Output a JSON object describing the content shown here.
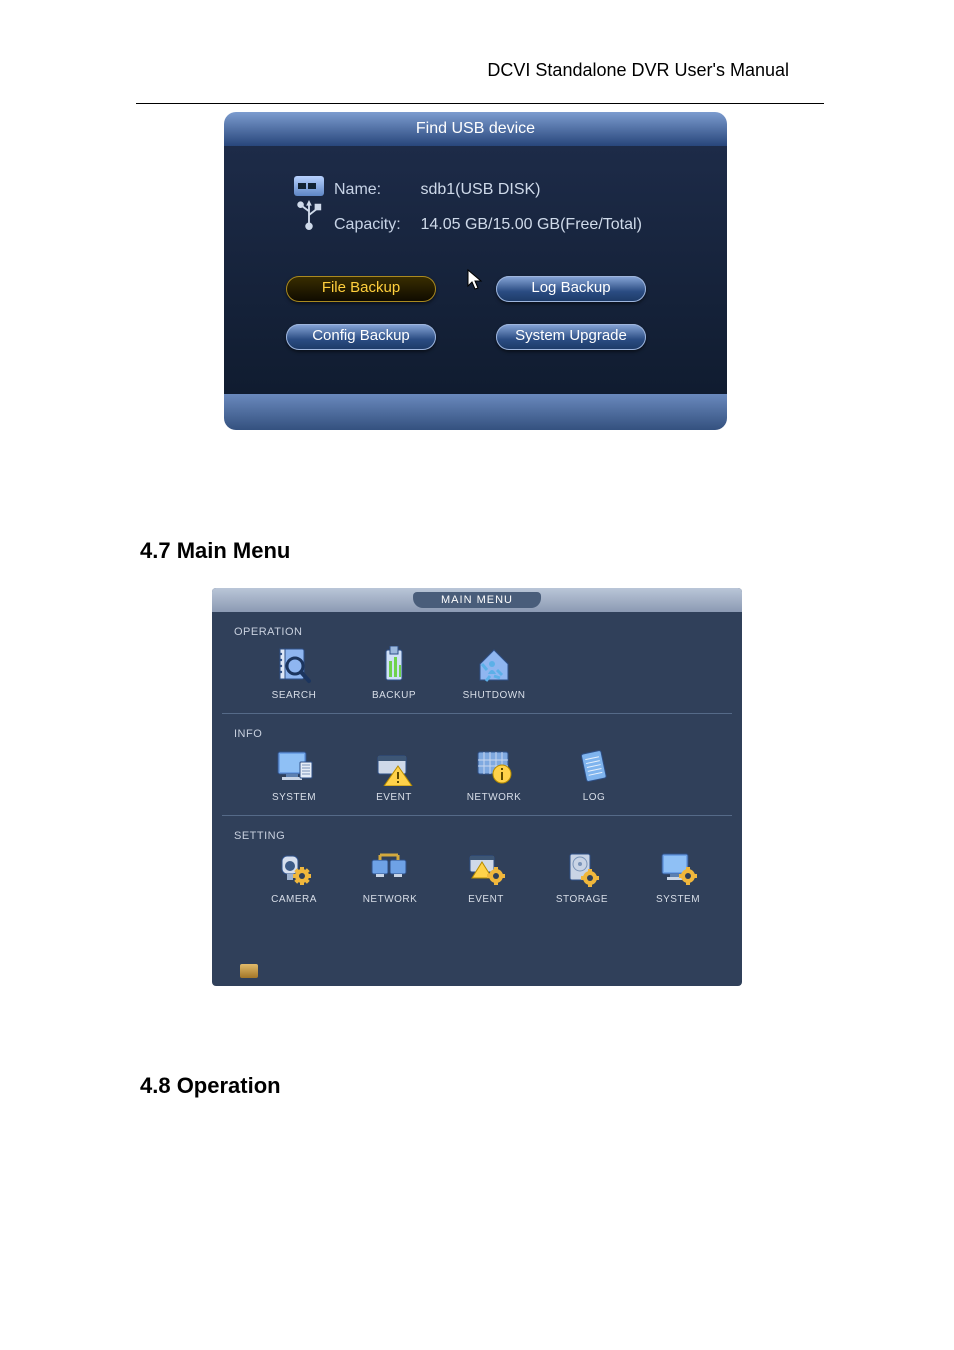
{
  "header": "DCVI Standalone DVR User's Manual",
  "usbDialog": {
    "title": "Find USB device",
    "nameLabel": "Name:",
    "nameValue": "sdb1(USB DISK)",
    "capLabel": "Capacity:",
    "capValue": "14.05 GB/15.00 GB(Free/Total)",
    "btnFileBackup": "File Backup",
    "btnLogBackup": "Log Backup",
    "btnConfigBackup": "Config Backup",
    "btnSystemUpgrade": "System Upgrade"
  },
  "section47": "4.7  Main Menu",
  "section48": "4.8  Operation",
  "mainMenu": {
    "title": "MAIN MENU",
    "catOperation": "OPERATION",
    "catInfo": "INFO",
    "catSetting": "SETTING",
    "operation": {
      "search": "SEARCH",
      "backup": "BACKUP",
      "shutdown": "SHUTDOWN"
    },
    "info": {
      "system": "SYSTEM",
      "event": "EVENT",
      "network": "NETWORK",
      "log": "LOG"
    },
    "setting": {
      "camera": "CAMERA",
      "network": "NETWORK",
      "event": "EVENT",
      "storage": "STORAGE",
      "system": "SYSTEM"
    }
  }
}
